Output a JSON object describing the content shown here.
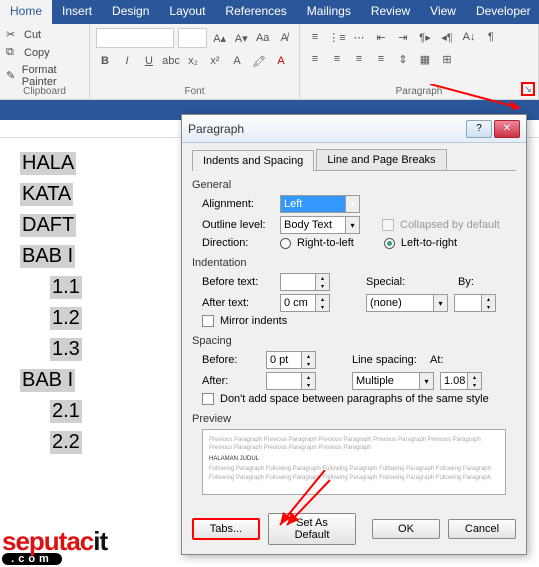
{
  "ribbon": {
    "tabs": [
      "Home",
      "Insert",
      "Design",
      "Layout",
      "References",
      "Mailings",
      "Review",
      "View",
      "Developer"
    ],
    "active_tab": 0,
    "clipboard": {
      "cut": "Cut",
      "copy": "Copy",
      "fp": "Format Painter",
      "label": "Clipboard"
    },
    "font": {
      "label": "Font"
    },
    "paragraph": {
      "label": "Paragraph"
    }
  },
  "document": {
    "lines": [
      "HALA",
      "KATA",
      "DAFT",
      "BAB I",
      "1.1",
      "1.2",
      "1.3",
      "BAB I",
      "2.1",
      "2.2"
    ]
  },
  "dialog": {
    "title": "Paragraph",
    "tabs": {
      "t1": "Indents and Spacing",
      "t2": "Line and Page Breaks"
    },
    "general": {
      "label": "General",
      "alignment_label": "Alignment:",
      "alignment_value": "Left",
      "outline_label": "Outline level:",
      "outline_value": "Body Text",
      "collapsed": "Collapsed by default",
      "direction_label": "Direction:",
      "rtl": "Right-to-left",
      "ltr": "Left-to-right"
    },
    "indentation": {
      "label": "Indentation",
      "before_label": "Before text:",
      "before_value": "",
      "after_label": "After text:",
      "after_value": "0 cm",
      "special_label": "Special:",
      "special_value": "(none)",
      "by_label": "By:",
      "by_value": "",
      "mirror": "Mirror indents"
    },
    "spacing": {
      "label": "Spacing",
      "before_label": "Before:",
      "before_value": "0 pt",
      "after_label": "After:",
      "after_value": "",
      "line_label": "Line spacing:",
      "line_value": "Multiple",
      "at_label": "At:",
      "at_value": "1.08",
      "noadd": "Don't add space between paragraphs of the same style"
    },
    "preview": {
      "label": "Preview",
      "sample": "HALAMAN JUDUL"
    },
    "buttons": {
      "tabs": "Tabs...",
      "default": "Set As Default",
      "ok": "OK",
      "cancel": "Cancel"
    }
  },
  "logo": {
    "t1": "seputac",
    "t2": "it",
    "sub": ".com"
  }
}
